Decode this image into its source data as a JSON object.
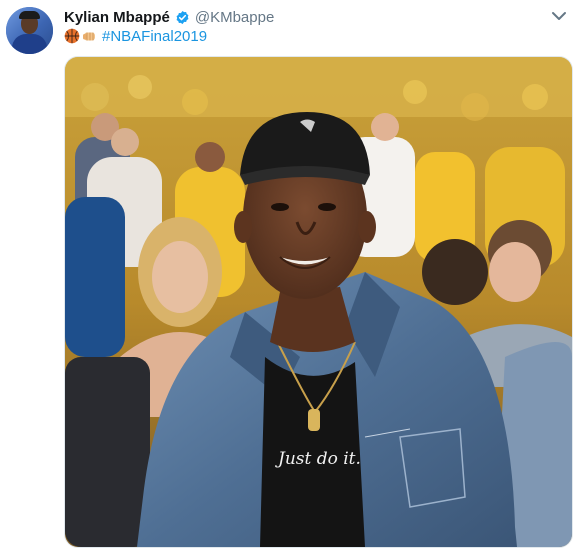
{
  "tweet": {
    "display_name": "Kylian Mbappé",
    "handle": "@KMbappe",
    "verified": true,
    "emojis": [
      "basketball-icon",
      "fist-bump-icon"
    ],
    "hashtag": "#NBAFinal2019",
    "shirt_text": "Just do it."
  },
  "colors": {
    "name": "#14171a",
    "handle": "#657786",
    "link": "#1b95e0",
    "verified": "#1da1f2"
  }
}
